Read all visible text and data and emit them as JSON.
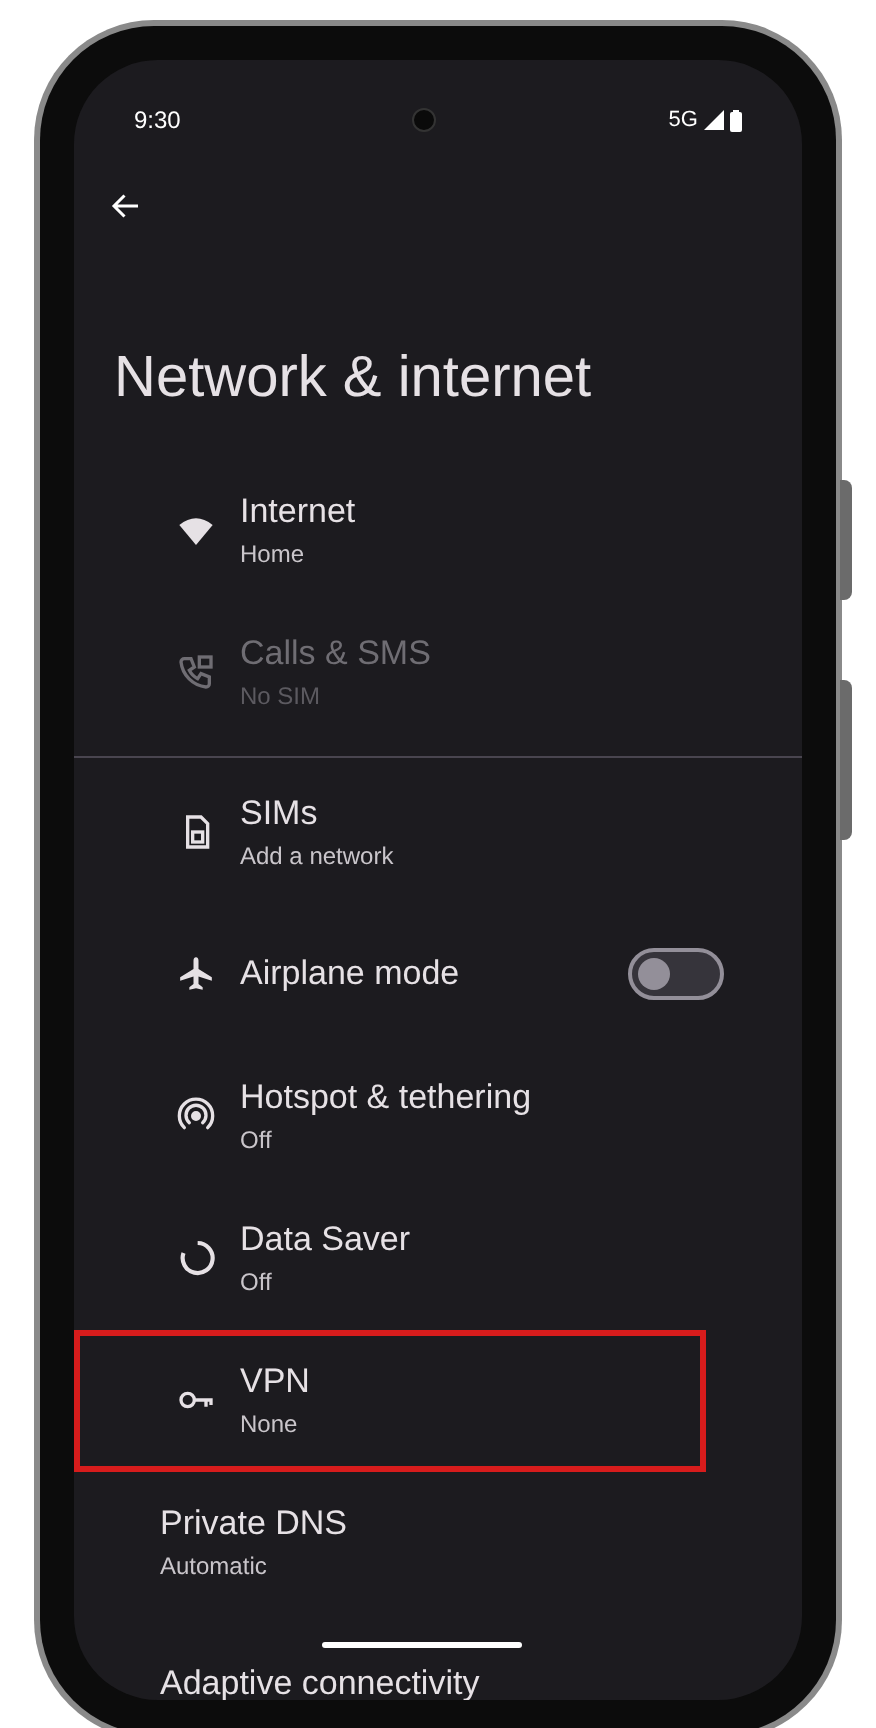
{
  "status_bar": {
    "time": "9:30",
    "network": "5G"
  },
  "title": "Network & internet",
  "sections": [
    [
      {
        "kind": "nav",
        "title": "Internet",
        "subtitle": "Home",
        "disabled": false,
        "highlighted": false
      },
      {
        "kind": "nav",
        "title": "Calls & SMS",
        "subtitle": "No SIM",
        "disabled": true,
        "highlighted": false
      }
    ],
    [
      {
        "kind": "nav",
        "title": "SIMs",
        "subtitle": "Add a network",
        "disabled": false,
        "highlighted": false
      },
      {
        "kind": "toggle",
        "title": "Airplane mode",
        "on": false,
        "disabled": false,
        "highlighted": false
      },
      {
        "kind": "nav",
        "title": "Hotspot & tethering",
        "subtitle": "Off",
        "disabled": false,
        "highlighted": false
      },
      {
        "kind": "nav",
        "title": "Data Saver",
        "subtitle": "Off",
        "disabled": false,
        "highlighted": false
      },
      {
        "kind": "nav",
        "title": "VPN",
        "subtitle": "None",
        "disabled": false,
        "highlighted": true
      },
      {
        "kind": "plain",
        "title": "Private DNS",
        "subtitle": "Automatic",
        "disabled": false,
        "highlighted": false
      },
      {
        "kind": "plain",
        "title": "Adaptive connectivity",
        "disabled": false,
        "highlighted": false
      }
    ]
  ]
}
